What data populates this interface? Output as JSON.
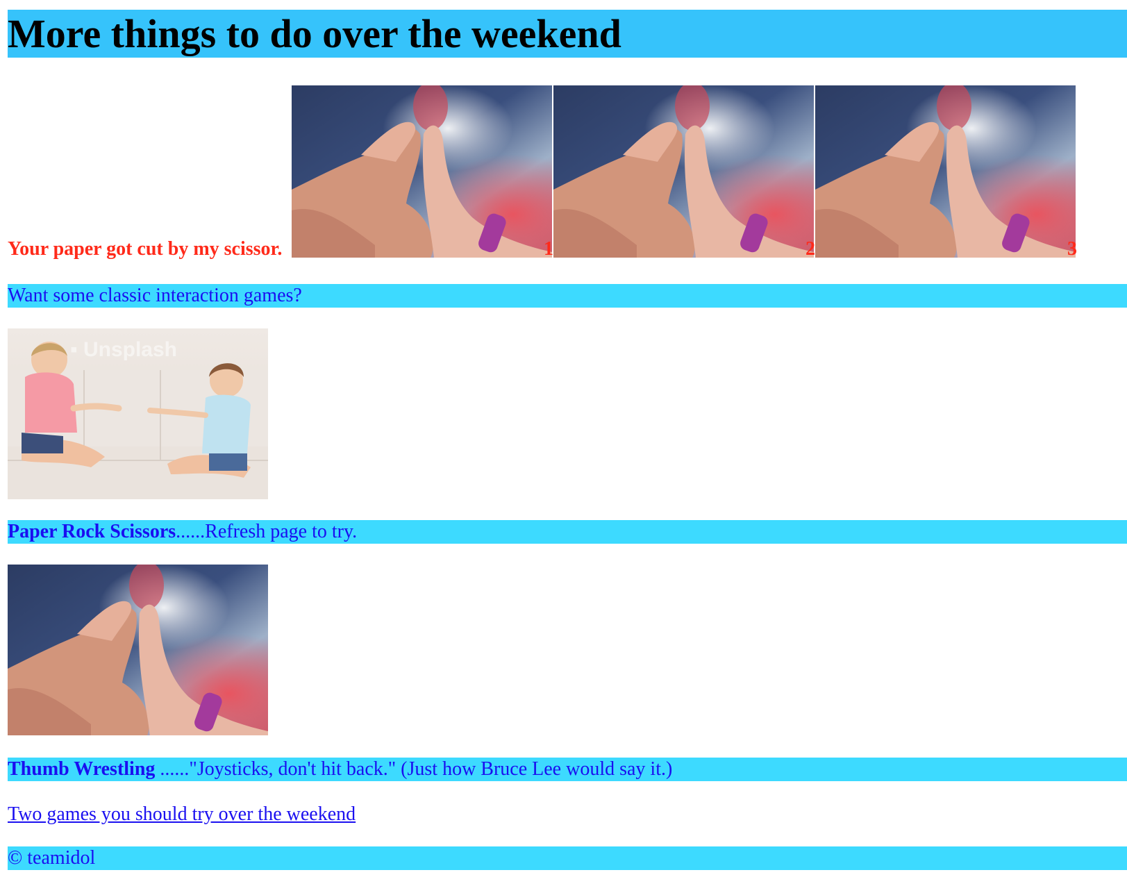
{
  "page": {
    "title": "More things to do over the weekend"
  },
  "result": {
    "text": "Your paper got cut by my scissor.",
    "labels": [
      "1",
      "2",
      "3"
    ]
  },
  "intro": {
    "text": "Want some classic interaction games?"
  },
  "games": [
    {
      "name": "Paper Rock Scissors",
      "description": "......Refresh page to try.",
      "image_icon": "kids-playing-rock-paper-scissors-photo"
    },
    {
      "name": "Thumb Wrestling",
      "description": " ......\"Joysticks, don't hit back.\" (Just how Bruce Lee would say it.)",
      "image_icon": "thumb-wrestling-hands-photo"
    }
  ],
  "link": {
    "text": "Two games you should try over the weekend"
  },
  "footer": {
    "text": "© teamidol"
  },
  "colors": {
    "heading_bg": "#36c3fb",
    "band_bg": "#3ddaff",
    "link_blue": "#1a0ff0",
    "result_red": "#ff2a1a"
  }
}
